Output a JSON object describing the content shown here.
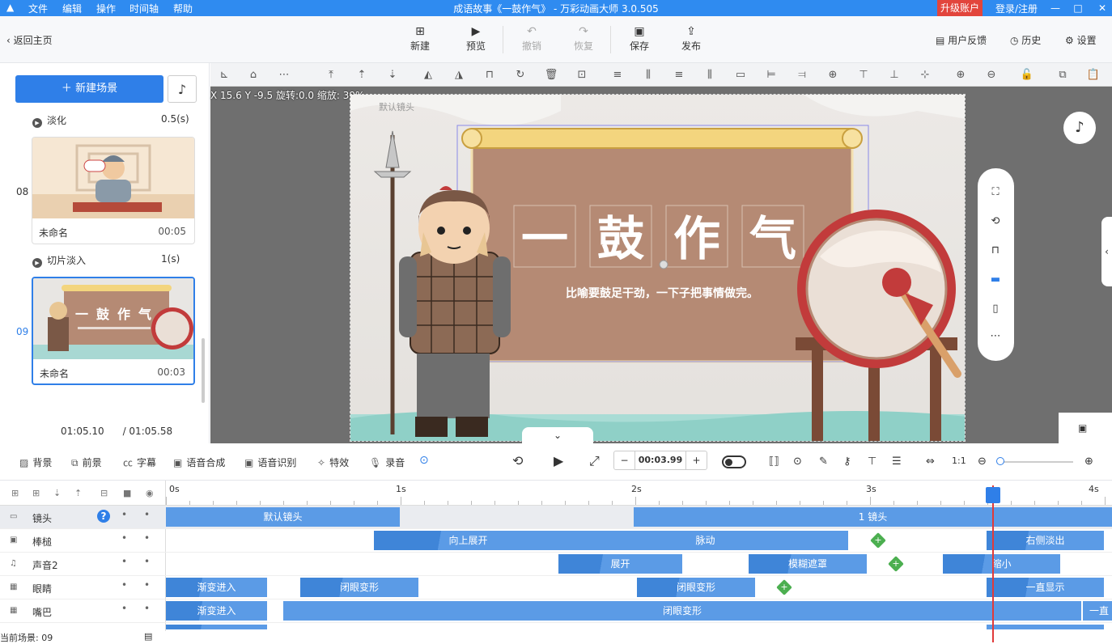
{
  "titlebar": {
    "menus": [
      "文件",
      "编辑",
      "操作",
      "时间轴",
      "帮助"
    ],
    "title": "成语故事《一鼓作气》 - 万彩动画大师 3.0.505",
    "upgrade": "升级账户",
    "login": "登录/注册",
    "win": [
      "—",
      "□",
      "✕"
    ]
  },
  "toolbar": {
    "back": "返回主页",
    "buttons": [
      {
        "label": "新建",
        "icon": "plus-square-icon",
        "disabled": false
      },
      {
        "label": "预览",
        "icon": "play-icon",
        "disabled": false
      },
      {
        "label": "撤销",
        "icon": "undo-icon",
        "disabled": true
      },
      {
        "label": "恢复",
        "icon": "redo-icon",
        "disabled": true
      },
      {
        "label": "保存",
        "icon": "save-icon",
        "disabled": false
      },
      {
        "label": "发布",
        "icon": "publish-icon",
        "disabled": false
      }
    ],
    "right": [
      "用户反馈",
      "历史",
      "设置"
    ]
  },
  "leftpanel": {
    "new_scene": "新建场景",
    "transitions": [
      {
        "name": "淡化",
        "dur": "0.5(s)"
      },
      {
        "name": "切片淡入",
        "dur": "1(s)"
      }
    ],
    "scenes": [
      {
        "num": "08",
        "name": "未命名",
        "time": "00:05",
        "selected": false
      },
      {
        "num": "09",
        "name": "未命名",
        "time": "00:03",
        "selected": true
      }
    ],
    "current_time": "01:05.10",
    "total_time": "/ 01:05.58"
  },
  "canvas": {
    "coord": "X 15.6 Y -9.5 旋转:0.0 缩放: 39%",
    "camera_label": "默认镜头",
    "scroll_title": "一 鼓 作 气",
    "scroll_chars": [
      "一",
      "鼓",
      "作",
      "气"
    ],
    "scroll_subtitle": "比喻要鼓足干劲，一下子把事情做完。"
  },
  "bottombar": {
    "items": [
      "背景",
      "前景",
      "字幕",
      "语音合成",
      "语音识别",
      "特效",
      "录音"
    ],
    "time": "00:03.99",
    "minus": "−",
    "plus": "+"
  },
  "timeline": {
    "ruler": [
      "0s",
      "1s",
      "2s",
      "3s",
      "4s"
    ],
    "tracks": [
      {
        "name": "镜头",
        "selected": true
      },
      {
        "name": "棒槌",
        "selected": false
      },
      {
        "name": "声音2",
        "selected": false
      },
      {
        "name": "眼睛",
        "selected": false
      },
      {
        "name": "嘴巴",
        "selected": false
      }
    ],
    "clips": {
      "camera": [
        "默认镜头",
        "1 镜头"
      ],
      "stick": [
        "向上展开",
        "脉动",
        "右侧淡出"
      ],
      "sound": [
        "展开",
        "模糊遮罩",
        "缩小"
      ],
      "eyes": [
        "渐变进入",
        "闭眼变形",
        "闭眼变形",
        "一直显示"
      ],
      "mouth": [
        "渐变进入",
        "闭眼变形",
        "一直"
      ]
    }
  },
  "status": "当前场景: 09",
  "colors": {
    "accent": "#2f7fe8",
    "titlebar": "#2f8bf0",
    "playhead": "#e03a3a",
    "clip": "#5b9be6"
  }
}
